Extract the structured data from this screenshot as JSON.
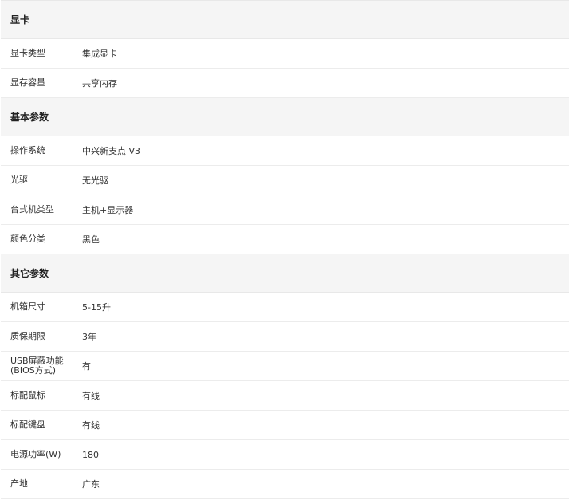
{
  "sections": [
    {
      "title": "显卡",
      "rows": [
        {
          "key": "显卡类型",
          "value": "集成显卡"
        },
        {
          "key": "显存容量",
          "value": "共享内存"
        }
      ]
    },
    {
      "title": "基本参数",
      "rows": [
        {
          "key": "操作系统",
          "value": "中兴新支点 V3"
        },
        {
          "key": "光驱",
          "value": "无光驱"
        },
        {
          "key": "台式机类型",
          "value": "主机+显示器"
        },
        {
          "key": "颜色分类",
          "value": "黑色"
        }
      ]
    },
    {
      "title": "其它参数",
      "rows": [
        {
          "key": "机箱尺寸",
          "value": "5-15升"
        },
        {
          "key": "质保期限",
          "value": "3年"
        },
        {
          "key": "USB屏蔽功能\n(BIOS方式)",
          "value": "有"
        },
        {
          "key": "标配鼠标",
          "value": "有线"
        },
        {
          "key": "标配键盘",
          "value": "有线"
        },
        {
          "key": "电源功率(W)",
          "value": "180"
        },
        {
          "key": "产地",
          "value": "广东"
        }
      ]
    }
  ]
}
